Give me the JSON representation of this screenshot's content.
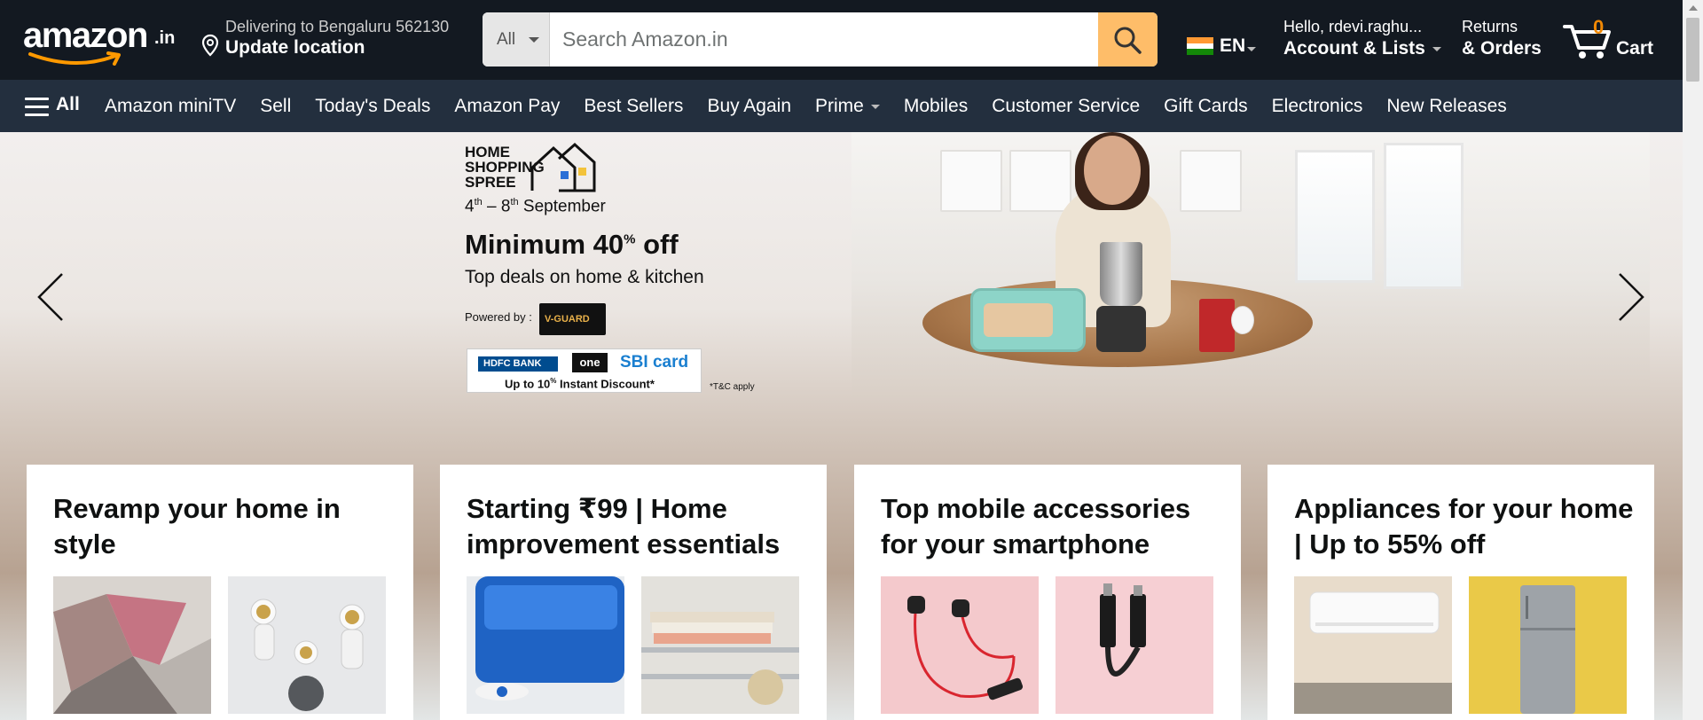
{
  "header": {
    "logo_text": "amazon",
    "logo_suffix": ".in",
    "deliver_line1": "Delivering to Bengaluru 562130",
    "deliver_line2": "Update location",
    "search_category": "All",
    "search_placeholder": "Search Amazon.in",
    "search_value": "",
    "language": "EN",
    "account_line1": "Hello, rdevi.raghu...",
    "account_line2": "Account & Lists",
    "returns_line1": "Returns",
    "returns_line2": "& Orders",
    "cart_count": "0",
    "cart_label": "Cart"
  },
  "nav": {
    "all_label": "All",
    "links": [
      {
        "label": "Amazon miniTV"
      },
      {
        "label": "Sell"
      },
      {
        "label": "Today's Deals"
      },
      {
        "label": "Amazon Pay"
      },
      {
        "label": "Best Sellers"
      },
      {
        "label": "Buy Again"
      },
      {
        "label": "Prime"
      },
      {
        "label": "Mobiles"
      },
      {
        "label": "Customer Service"
      },
      {
        "label": "Gift Cards"
      },
      {
        "label": "Electronics"
      },
      {
        "label": "New Releases"
      }
    ]
  },
  "hero": {
    "brand_line1": "HOME",
    "brand_line2": "SHOPPING",
    "brand_line3": "SPREE",
    "date_start": "4",
    "date_start_sup": "th",
    "date_mid": " – 8",
    "date_end_sup": "th",
    "date_tail": " September",
    "title_main": "Minimum 40",
    "title_sup": "%",
    "title_tail": " off",
    "subtitle": "Top deals on home & kitchen",
    "powered_by": "Powered by :",
    "sponsor": "V-GUARD",
    "bank1": "HDFC BANK",
    "bank2": "one",
    "bank3": "SBI card",
    "discount_main": "Up to 10",
    "discount_sup": "%",
    "discount_tail": " Instant Discount*",
    "tnc": "*T&C apply"
  },
  "cards": [
    {
      "title": "Revamp your home in style"
    },
    {
      "title": "Starting ₹99 | Home improvement essentials"
    },
    {
      "title": "Top mobile accessories for your smartphone"
    },
    {
      "title": "Appliances for your home | Up to 55% off"
    }
  ],
  "colors": {
    "nav_dark": "#131921",
    "nav_secondary": "#232f3e",
    "search_button": "#febd69",
    "cart_count": "#f08804"
  }
}
